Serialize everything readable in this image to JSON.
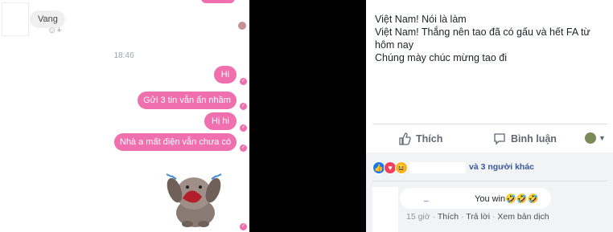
{
  "messenger": {
    "incoming_message": "Vang",
    "react_glyph": "☺+",
    "timestamp": "18:46",
    "messages": [
      "Hi",
      "Gửi 3 tin vẫn ẩn nhầm",
      "Hị hi",
      "Nhà a mất điện vẫn chưa có"
    ],
    "sticker_icon": "crying-dog-sticker-icon",
    "accent": "#f06fae"
  },
  "facebook": {
    "post_lines": [
      "Việt Nam! Nói là làm",
      "Việt Nam! Thắng nên tao đã có gấu và hết FA từ hôm nay",
      "Chúng mày chúc mừng tao đi"
    ],
    "actions": {
      "like_label": "Thích",
      "comment_label": "Bình luận"
    },
    "reactions": {
      "others_text": "và 3 người khác"
    },
    "comment": {
      "name": "_",
      "text": "You win🤣🤣🤣",
      "time": "15 giờ",
      "like": "Thích",
      "reply": "Trả lời",
      "translate": "Xem bản dịch",
      "sep": "·"
    },
    "colors": {
      "link": "#385898",
      "like_blue": "#1877f2",
      "love_red": "#f33e58"
    }
  }
}
